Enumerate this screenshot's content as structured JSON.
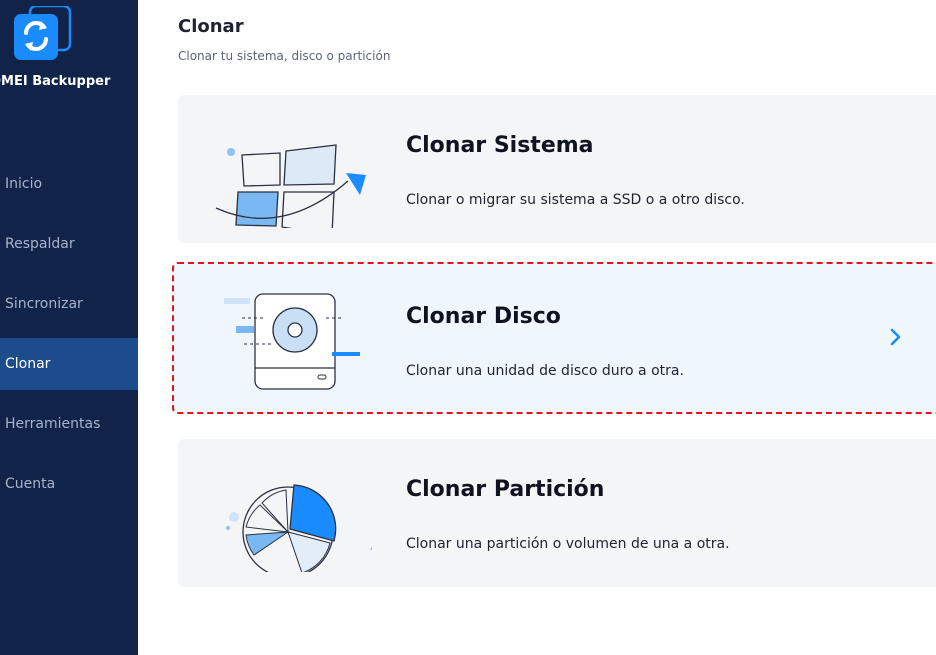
{
  "sidebar": {
    "app_name": "OMEI Backupper",
    "items": [
      {
        "label": "Inicio"
      },
      {
        "label": "Respaldar"
      },
      {
        "label": "Sincronizar"
      },
      {
        "label": "Clonar",
        "active": true
      },
      {
        "label": "Herramientas"
      },
      {
        "label": "Cuenta"
      }
    ]
  },
  "main": {
    "title": "Clonar",
    "subtitle": "Clonar tu sistema, disco o partición",
    "cards": [
      {
        "title": "Clonar Sistema",
        "desc": "Clonar o migrar su sistema a SSD o a otro disco.",
        "icon": "windows-system-icon"
      },
      {
        "title": "Clonar Disco",
        "desc": "Clonar una unidad de disco duro a otra.",
        "icon": "hard-disk-icon",
        "selected": true
      },
      {
        "title": "Clonar Partición",
        "desc": "Clonar una partición o volumen de una a otra.",
        "icon": "pie-partition-icon"
      }
    ]
  },
  "colors": {
    "sidebar_bg": "#12234a",
    "sidebar_active": "#1c4c8c",
    "accent": "#1a8cff",
    "selection_border": "#e0141a"
  }
}
